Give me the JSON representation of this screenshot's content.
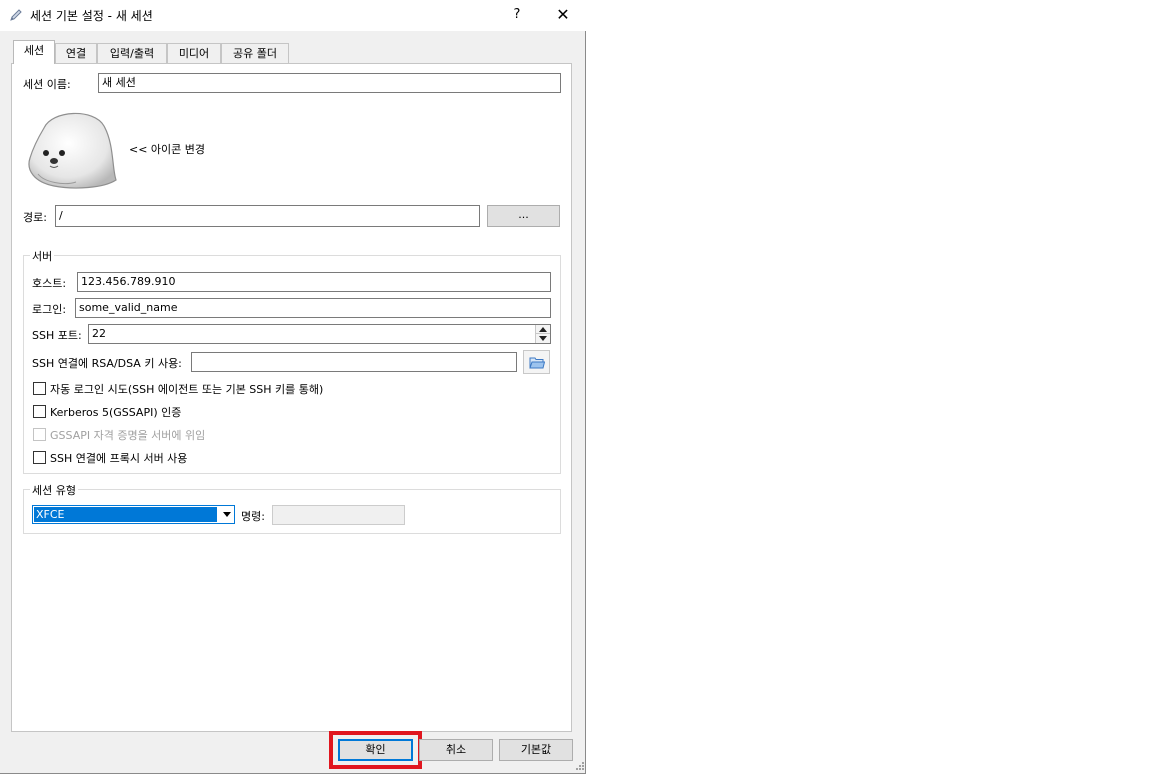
{
  "window": {
    "title": "세션 기본 설정 - 새 세션",
    "help_label": "?",
    "close_label": "✕"
  },
  "tabs": [
    {
      "label": "세션",
      "active": true
    },
    {
      "label": "연결"
    },
    {
      "label": "입력/출력"
    },
    {
      "label": "미디어"
    },
    {
      "label": "공유 폴더"
    }
  ],
  "session": {
    "name_label": "세션 이름:",
    "name_value": "새 세션",
    "icon_change_label": "<< 아이콘 변경",
    "path_label": "경로:",
    "path_value": "/",
    "browse_label": "..."
  },
  "server": {
    "group_title": "서버",
    "host_label": "호스트:",
    "host_value": "123.456.789.910",
    "login_label": "로그인:",
    "login_value": "some_valid_name",
    "port_label": "SSH 포트:",
    "port_value": "22",
    "key_label": "SSH 연결에 RSA/DSA 키 사용:",
    "key_value": "",
    "checkboxes": [
      {
        "label": "자동 로그인 시도(SSH 에이전트 또는 기본 SSH 키를 통해)",
        "checked": false,
        "disabled": false
      },
      {
        "label": "Kerberos 5(GSSAPI) 인증",
        "checked": false,
        "disabled": false
      },
      {
        "label": "GSSAPI 자격 증명을 서버에 위임",
        "checked": false,
        "disabled": true
      },
      {
        "label": "SSH 연결에 프록시 서버 사용",
        "checked": false,
        "disabled": false
      }
    ]
  },
  "session_type": {
    "group_title": "세션 유형",
    "selected": "XFCE",
    "command_label": "명령:",
    "command_value": ""
  },
  "footer": {
    "ok_label": "확인",
    "cancel_label": "취소",
    "default_label": "기본값"
  },
  "colors": {
    "highlight": "#e0161f",
    "focus_blue": "#0078d7"
  }
}
